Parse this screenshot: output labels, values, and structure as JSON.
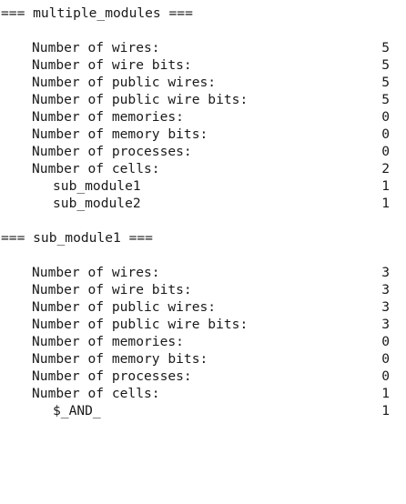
{
  "modules": [
    {
      "header": "=== multiple_modules ===",
      "stats": [
        {
          "label": "Number of wires:",
          "value": "5"
        },
        {
          "label": "Number of wire bits:",
          "value": "5"
        },
        {
          "label": "Number of public wires:",
          "value": "5"
        },
        {
          "label": "Number of public wire bits:",
          "value": "5"
        },
        {
          "label": "Number of memories:",
          "value": "0"
        },
        {
          "label": "Number of memory bits:",
          "value": "0"
        },
        {
          "label": "Number of processes:",
          "value": "0"
        },
        {
          "label": "Number of cells:",
          "value": "2"
        }
      ],
      "cells": [
        {
          "label": "sub_module1",
          "value": "1"
        },
        {
          "label": "sub_module2",
          "value": "1"
        }
      ]
    },
    {
      "header": "=== sub_module1 ===",
      "stats": [
        {
          "label": "Number of wires:",
          "value": "3"
        },
        {
          "label": "Number of wire bits:",
          "value": "3"
        },
        {
          "label": "Number of public wires:",
          "value": "3"
        },
        {
          "label": "Number of public wire bits:",
          "value": "3"
        },
        {
          "label": "Number of memories:",
          "value": "0"
        },
        {
          "label": "Number of memory bits:",
          "value": "0"
        },
        {
          "label": "Number of processes:",
          "value": "0"
        },
        {
          "label": "Number of cells:",
          "value": "1"
        }
      ],
      "cells": [
        {
          "label": "$_AND_",
          "value": "1"
        }
      ]
    }
  ]
}
